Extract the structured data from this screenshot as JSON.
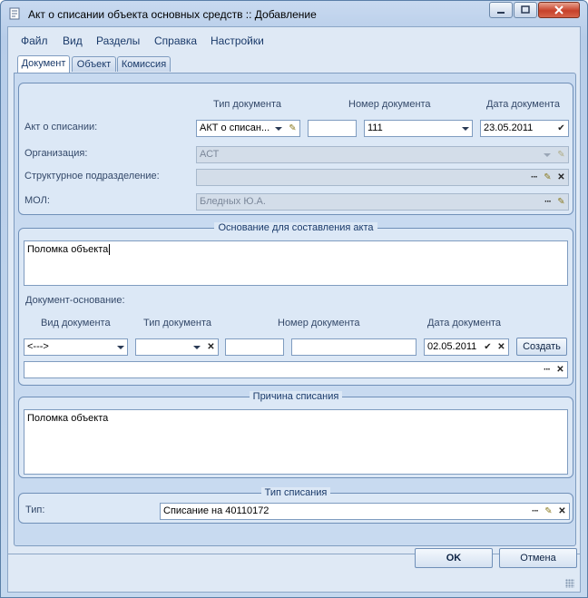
{
  "window": {
    "title": "Акт о списании объекта основных средств :: Добавление",
    "min_icon": "minimize-icon",
    "max_icon": "maximize-icon",
    "close_icon": "close-icon"
  },
  "menu": [
    "Файл",
    "Вид",
    "Разделы",
    "Справка",
    "Настройки"
  ],
  "tabs": [
    "Документ",
    "Объект",
    "Комиссия"
  ],
  "header": {
    "col_type": "Тип документа",
    "col_number": "Номер документа",
    "col_date": "Дата документа",
    "act_label": "Акт о списании:",
    "act_type_value": "АКТ о списан...",
    "act_series_value": "",
    "act_number_value": "111",
    "act_date_value": "23.05.2011",
    "org_label": "Организация:",
    "org_value": "АСТ",
    "dept_label": "Структурное подразделение:",
    "dept_value": "",
    "mol_label": "МОЛ:",
    "mol_value": "Бледных Ю.А."
  },
  "basis": {
    "title": "Основание для составления акта",
    "text": "Поломка объекта",
    "doc_basis_label": "Документ-основание:",
    "col_kind": "Вид документа",
    "col_type": "Тип документа",
    "col_number": "Номер документа",
    "col_date": "Дата документа",
    "kind_value": "<--->",
    "type_value": "",
    "series_value": "",
    "number_value": "",
    "date_value": "02.05.2011",
    "create_label": "Создать",
    "link_value": ""
  },
  "reason": {
    "title": "Причина списания",
    "text": "Поломка объекта"
  },
  "writeoff": {
    "title": "Тип списания",
    "type_label": "Тип:",
    "type_value": "Списание на 40110172"
  },
  "footer": {
    "ok_label": "OK",
    "cancel_label": "Отмена"
  },
  "colors": {
    "window_bg": "#c9daf0",
    "group_bg": "#dce8f6",
    "border": "#7f9cc0",
    "close_button": "#c7412a"
  }
}
